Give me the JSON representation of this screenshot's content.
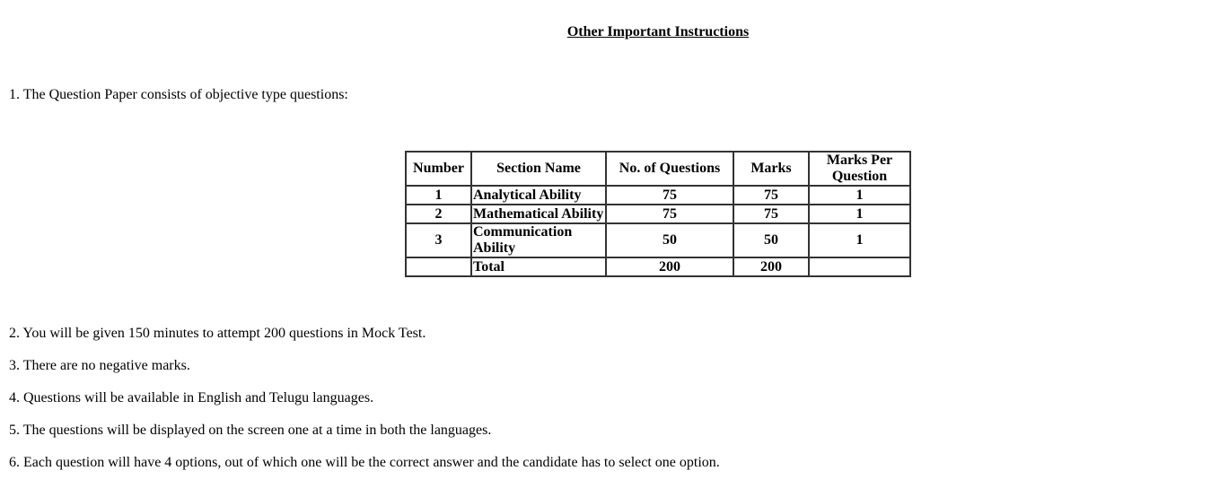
{
  "title": "Other Important Instructions",
  "intro": "1. The Question Paper consists of objective type questions:",
  "table": {
    "headers": [
      "Number",
      "Section Name",
      "No. of Questions",
      "Marks",
      "Marks Per Question"
    ],
    "rows": [
      [
        "1",
        "Analytical Ability",
        "75",
        "75",
        "1"
      ],
      [
        "2",
        "Mathematical Ability",
        "75",
        "75",
        "1"
      ],
      [
        "3",
        "Communication Ability",
        "50",
        "50",
        "1"
      ],
      [
        "",
        "Total",
        "200",
        "200",
        ""
      ]
    ]
  },
  "instructions": [
    "2. You will be given 150 minutes to attempt 200 questions in Mock Test.",
    "3. There are no negative marks.",
    "4. Questions will be available in English and Telugu languages.",
    "5. The questions will be displayed on the screen one at a time in both the languages.",
    "6. Each question will have 4 options, out of which one will be the correct answer and the candidate has to select one option."
  ]
}
